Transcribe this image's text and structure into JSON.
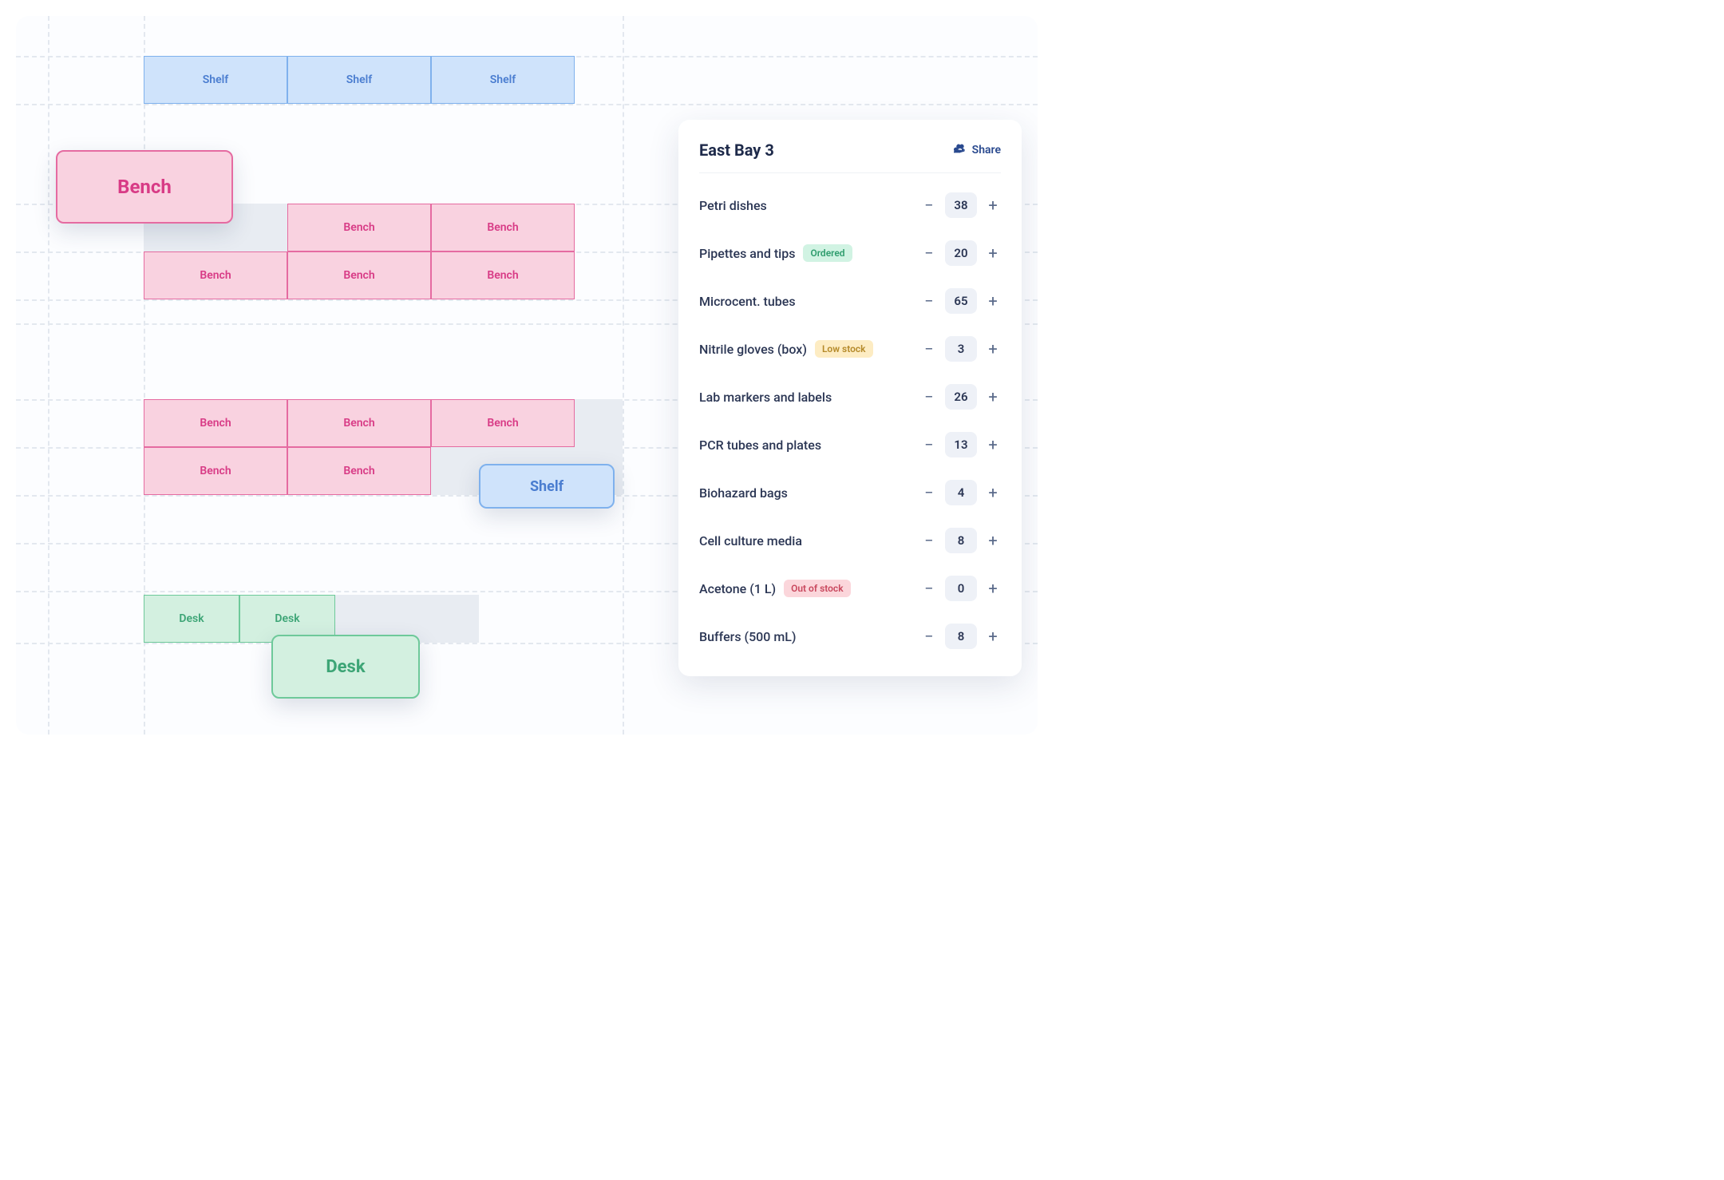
{
  "layout": {
    "shelf_label": "Shelf",
    "bench_label": "Bench",
    "desk_label": "Desk",
    "lifted_bench_label": "Bench",
    "lifted_shelf_label": "Shelf",
    "lifted_desk_label": "Desk"
  },
  "panel": {
    "title": "East Bay 3",
    "share_label": "Share",
    "items": [
      {
        "name": "Petri dishes",
        "count": "38",
        "badge": null
      },
      {
        "name": "Pipettes and tips",
        "count": "20",
        "badge": {
          "text": "Ordered",
          "type": "ordered"
        }
      },
      {
        "name": "Microcent. tubes",
        "count": "65",
        "badge": null
      },
      {
        "name": "Nitrile gloves (box)",
        "count": "3",
        "badge": {
          "text": "Low stock",
          "type": "low"
        }
      },
      {
        "name": "Lab markers and labels",
        "count": "26",
        "badge": null
      },
      {
        "name": "PCR tubes and plates",
        "count": "13",
        "badge": null
      },
      {
        "name": "Biohazard bags",
        "count": "4",
        "badge": null
      },
      {
        "name": "Cell culture media",
        "count": "8",
        "badge": null
      },
      {
        "name": "Acetone (1 L)",
        "count": "0",
        "badge": {
          "text": "Out of stock",
          "type": "out"
        }
      },
      {
        "name": "Buffers (500 mL)",
        "count": "8",
        "badge": null
      }
    ]
  }
}
